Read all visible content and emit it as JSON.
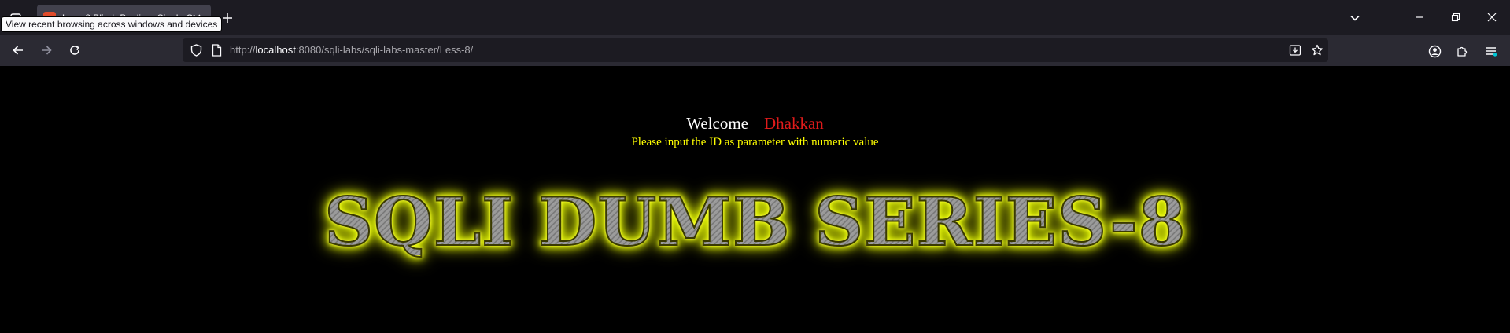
{
  "browser": {
    "active_tab": {
      "title": "Less-8 Blind- Boolian- Single Qu"
    },
    "tooltip": "View recent browsing across windows and devices",
    "url": {
      "scheme": "http://",
      "host": "localhost",
      "rest": ":8080/sqli-labs/sqli-labs-master/Less-8/"
    },
    "icons": {
      "firefox_view": "tab-list-icon",
      "new_tab": "plus-icon",
      "list_all_tabs": "chevron-down-icon",
      "back": "arrow-left-icon",
      "forward": "arrow-right-icon",
      "reload": "reload-icon",
      "tracking": "shield-icon",
      "page_info": "page-icon",
      "install": "download-app-icon",
      "bookmark": "star-icon",
      "account": "account-icon",
      "extensions": "puzzle-icon",
      "menu": "menu-icon"
    }
  },
  "page": {
    "welcome_label": "Welcome",
    "welcome_name": "Dhakkan",
    "instruction": "Please input the ID as parameter with numeric value",
    "banner": "SQLI DUMB SERIES-8",
    "colors": {
      "background": "#000000",
      "welcome": "#ffffff",
      "name": "#e11b1b",
      "instruction": "#ffff00",
      "banner_glow": "#e6ff00"
    }
  }
}
